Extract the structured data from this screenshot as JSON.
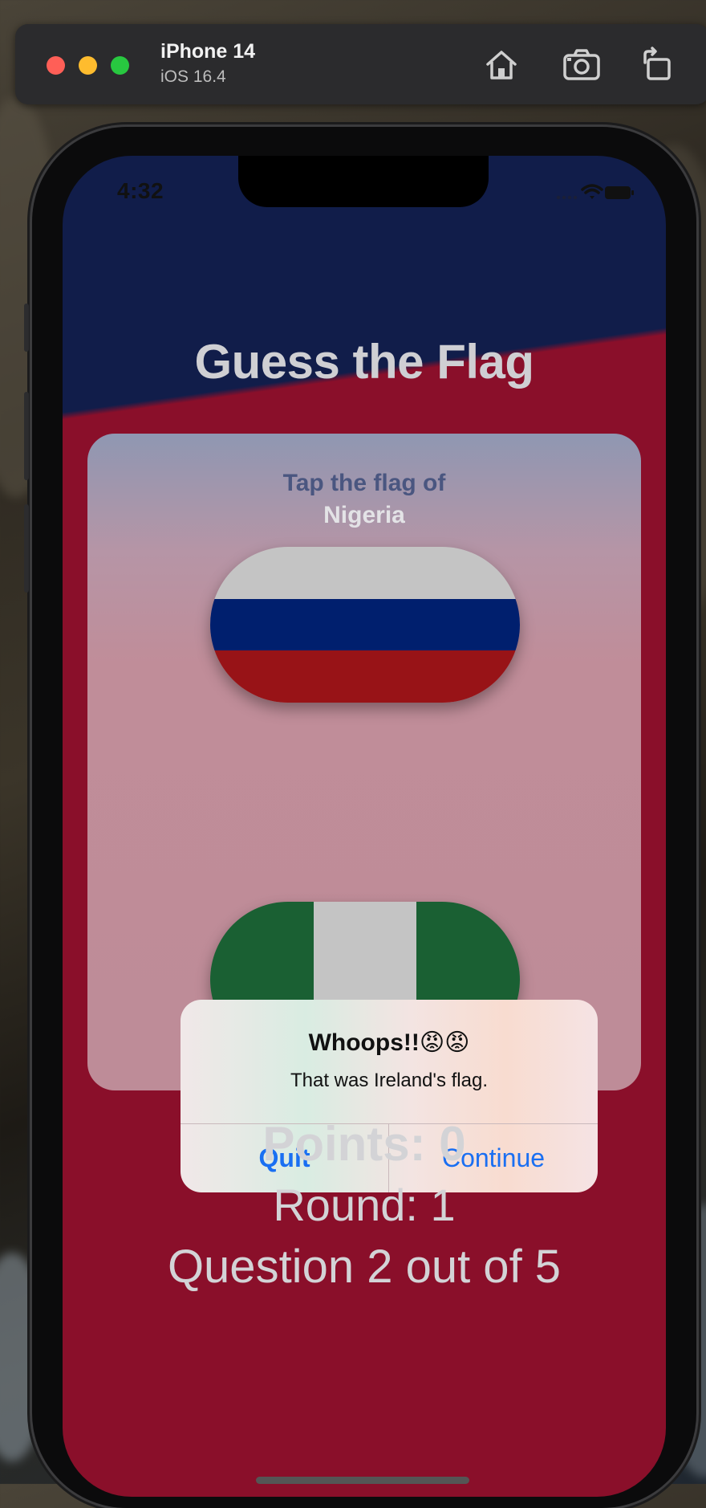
{
  "simulator": {
    "device_name": "iPhone 14",
    "os_version": "iOS 16.4",
    "traffic_lights": [
      "#ff5f57",
      "#febc2e",
      "#28c840"
    ],
    "toolbar_icons": [
      "home-icon",
      "screenshot-icon",
      "rotate-icon"
    ]
  },
  "status_bar": {
    "time": "4:32",
    "icons": [
      "wifi-icon",
      "battery-icon"
    ]
  },
  "app": {
    "title": "Guess the Flag",
    "prompt_line1": "Tap the flag of",
    "prompt_line2": "Nigeria",
    "flags": [
      {
        "country_flag": "Russia",
        "colors": [
          "#c4c4c4",
          "#001f6e",
          "#981317"
        ]
      },
      {
        "country_flag": "Nigeria",
        "colors": [
          "#1a6033",
          "#c4c4c4",
          "#1a6033"
        ]
      }
    ],
    "points": "Points: 0",
    "round": "Round: 1",
    "question": "Question 2 out of 5"
  },
  "alert": {
    "title": "Whoops!!😡😡",
    "message": "That was Ireland's flag.",
    "quit_label": "Quit",
    "continue_label": "Continue"
  },
  "colors": {
    "top_background": "#111d4a",
    "bottom_background": "#8a0f2a",
    "alert_button": "#1a6ff2"
  }
}
